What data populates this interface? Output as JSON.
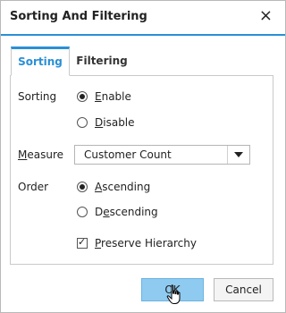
{
  "dialog": {
    "title": "Sorting And Filtering",
    "close_glyph": "×"
  },
  "tabs": [
    {
      "label": "Sorting",
      "active": true
    },
    {
      "label": "Filtering",
      "active": false
    }
  ],
  "sorting": {
    "label": "Sorting",
    "options": [
      {
        "accel": "E",
        "rest": "nable",
        "checked": true
      },
      {
        "accel": "D",
        "rest": "isable",
        "checked": false
      }
    ]
  },
  "measure": {
    "label_accel": "M",
    "label_rest": "easure",
    "value": "Customer Count"
  },
  "order": {
    "label": "Order",
    "options": [
      {
        "accel": "A",
        "rest": "scending",
        "checked": true
      },
      {
        "accel": "",
        "rest_pre": "D",
        "accel2": "e",
        "rest": "scending",
        "checked": false
      }
    ]
  },
  "preserve": {
    "accel": "P",
    "rest": "reserve Hierarchy",
    "checked": true
  },
  "buttons": {
    "ok": "OK",
    "cancel": "Cancel"
  },
  "colors": {
    "accent": "#2a8fd6",
    "ok_fill": "#8fcbf0"
  }
}
